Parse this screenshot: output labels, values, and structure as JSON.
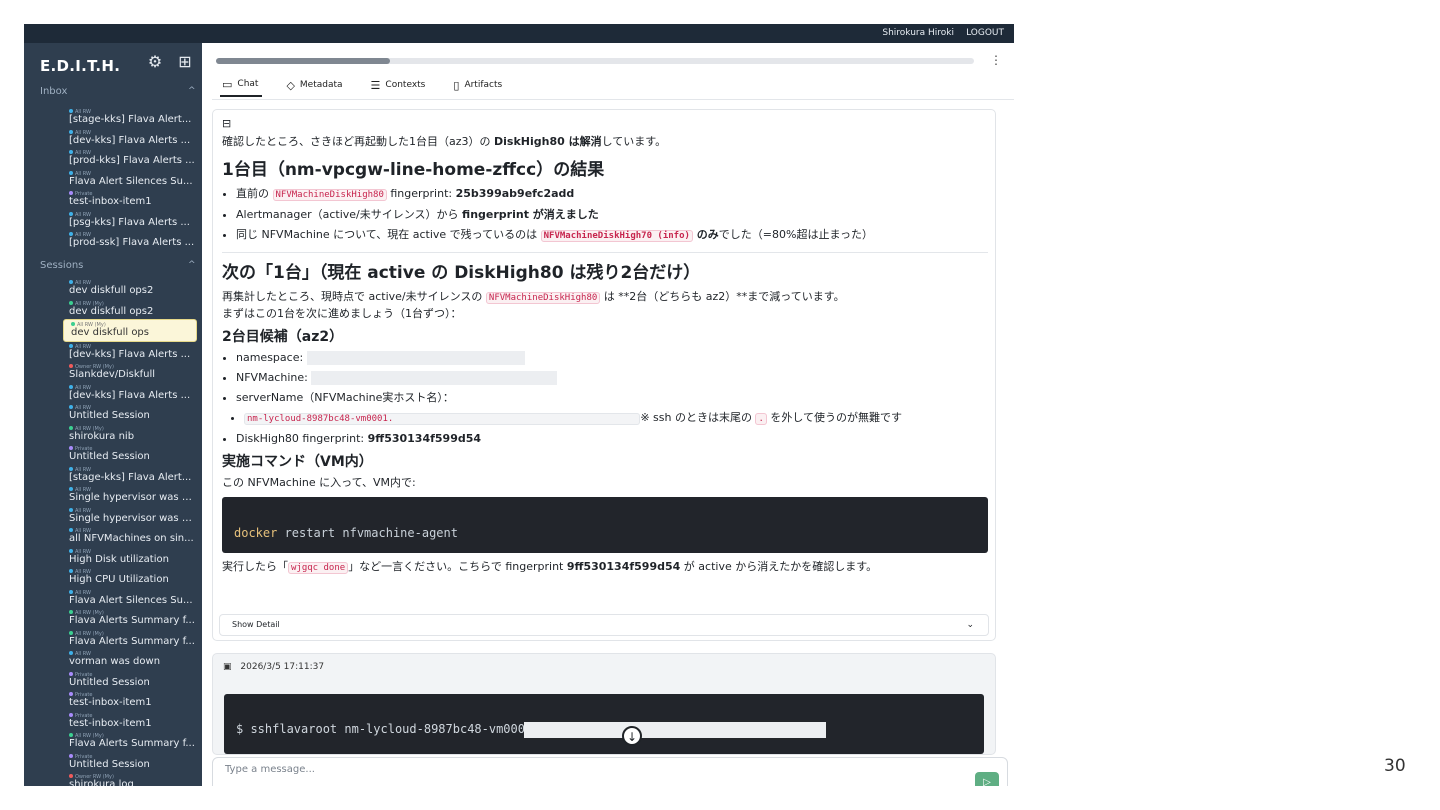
{
  "topbar": {
    "user": "Shirokura Hiroki",
    "logout": "LOGOUT"
  },
  "sidebar": {
    "brand": "E.D.I.T.H.",
    "inbox_label": "Inbox",
    "sessions_label": "Sessions",
    "inbox": [
      {
        "meta": "All RW",
        "label": "[stage-kks] Flava Alert...",
        "dot": "#3fb0e8"
      },
      {
        "meta": "All RW",
        "label": "[dev-kks] Flava Alerts ...",
        "dot": "#3fb0e8"
      },
      {
        "meta": "All RW",
        "label": "[prod-kks] Flava Alerts ...",
        "dot": "#3fb0e8"
      },
      {
        "meta": "All RW",
        "label": "Flava Alert Silences Su...",
        "dot": "#3fb0e8"
      },
      {
        "meta": "Private",
        "label": "test-inbox-item1",
        "dot": "#a78bfa"
      },
      {
        "meta": "All RW",
        "label": "[psg-kks] Flava Alerts ...",
        "dot": "#3fb0e8"
      },
      {
        "meta": "All RW",
        "label": "[prod-ssk] Flava Alerts ...",
        "dot": "#3fb0e8"
      }
    ],
    "sessions": [
      {
        "meta": "All RW",
        "label": "dev diskfull ops2",
        "dot": "#3fb0e8"
      },
      {
        "meta": "All RW (My)",
        "label": "dev diskfull ops2",
        "dot": "#3ccf91"
      },
      {
        "meta": "All RW (My)",
        "label": "dev diskfull ops",
        "dot": "#3ccf91",
        "active": true
      },
      {
        "meta": "All RW",
        "label": "[dev-kks] Flava Alerts ...",
        "dot": "#3fb0e8"
      },
      {
        "meta": "Owner RW (My)",
        "label": "Slankdev/Diskfull",
        "dot": "#ef5b5b"
      },
      {
        "meta": "All RW",
        "label": "[dev-kks] Flava Alerts ...",
        "dot": "#3fb0e8"
      },
      {
        "meta": "All RW",
        "label": "Untitled Session",
        "dot": "#3fb0e8"
      },
      {
        "meta": "All RW (My)",
        "label": "shirokura nib",
        "dot": "#3ccf91"
      },
      {
        "meta": "Private",
        "label": "Untitled Session",
        "dot": "#a78bfa"
      },
      {
        "meta": "All RW",
        "label": "[stage-kks] Flava Alert...",
        "dot": "#3fb0e8"
      },
      {
        "meta": "All RW",
        "label": "Single hypervisor was d...",
        "dot": "#3fb0e8"
      },
      {
        "meta": "All RW",
        "label": "Single hypervisor was d...",
        "dot": "#3fb0e8"
      },
      {
        "meta": "All RW",
        "label": "all NFVMachines on sin...",
        "dot": "#3fb0e8"
      },
      {
        "meta": "All RW",
        "label": "High Disk utilization",
        "dot": "#3fb0e8"
      },
      {
        "meta": "All RW",
        "label": "High CPU Utilization",
        "dot": "#3fb0e8"
      },
      {
        "meta": "All RW",
        "label": "Flava Alert Silences Su...",
        "dot": "#3fb0e8"
      },
      {
        "meta": "All RW (My)",
        "label": "Flava Alerts Summary f...",
        "dot": "#3ccf91"
      },
      {
        "meta": "All RW (My)",
        "label": "Flava Alerts Summary f...",
        "dot": "#3ccf91"
      },
      {
        "meta": "All RW",
        "label": "vorman was down",
        "dot": "#3fb0e8"
      },
      {
        "meta": "Private",
        "label": "Untitled Session",
        "dot": "#a78bfa"
      },
      {
        "meta": "Private",
        "label": "test-inbox-item1",
        "dot": "#a78bfa"
      },
      {
        "meta": "Private",
        "label": "test-inbox-item1",
        "dot": "#a78bfa"
      },
      {
        "meta": "All RW (My)",
        "label": "Flava Alerts Summary f...",
        "dot": "#3ccf91"
      },
      {
        "meta": "Private",
        "label": "Untitled Session",
        "dot": "#a78bfa"
      },
      {
        "meta": "Owner RW (My)",
        "label": "shirokura log",
        "dot": "#ef5b5b"
      }
    ]
  },
  "main": {
    "progress": 0.23,
    "tabs": [
      {
        "icon": "chat-icon",
        "label": "Chat"
      },
      {
        "icon": "tag-icon",
        "label": "Metadata"
      },
      {
        "icon": "database-icon",
        "label": "Contexts"
      },
      {
        "icon": "file-icon",
        "label": "Artifacts"
      }
    ],
    "message": {
      "intro_a": "確認したところ、さきほど再起動した1台目（az3）の ",
      "intro_b": "DiskHigh80 は解消",
      "intro_c": "しています。",
      "h1": "1台目（nm-vpcgw-line-home-zffcc）の結果",
      "b1_a": "直前の ",
      "b1_code": "NFVMachineDiskHigh80",
      "b1_b": " fingerprint: ",
      "b1_c": "25b399ab9efc2add",
      "b2_a": "Alertmanager（active/未サイレンス）から ",
      "b2_b": "fingerprint が消えました",
      "b3_a": "同じ NFVMachine について、現在 active で残っているのは ",
      "b3_code": "NFVMachineDiskHigh70 (info)",
      "b3_b": " のみ",
      "b3_c": "でした（=80%超は止まった）",
      "h2": "次の「1台」（現在 active の DiskHigh80 は残り2台だけ）",
      "p2_a": "再集計したところ、現時点で active/未サイレンスの ",
      "p2_code": "NFVMachineDiskHigh80",
      "p2_b": " は **2台（どちらも az2）**まで減っています。",
      "p2_c": "まずはこの1台を次に進めましょう（1台ずつ）：",
      "h3": "2台目候補（az2）",
      "c1": "namespace:",
      "c2": "NFVMachine:",
      "c3": "serverName（NFVMachine実ホスト名）：",
      "c4_code": "nm-lycloud-8987bc48-vm0001.",
      "c4_note_a": "※ ssh のときは末尾の ",
      "c4_note_code": ".",
      "c4_note_b": " を外して使うのが無難です",
      "c5_a": "DiskHigh80 fingerprint: ",
      "c5_b": "9ff530134f599d54",
      "h4": "実施コマンド（VM内）",
      "p4": "この NFVMachine に入って、VM内で:",
      "cmd_kw": "docker",
      "cmd_rest": " restart nfvmachine-agent",
      "p5_a": "実行したら「",
      "p5_code": "wjgqc done",
      "p5_b": "」など一言ください。こちらで fingerprint ",
      "p5_c": "9ff530134f599d54",
      "p5_d": " が active から消えたかを確認します。",
      "detail": "Show Detail"
    },
    "message2": {
      "timestamp": "2026/3/5 17:11:37",
      "cmd": "$ sshflavaroot nm-lycloud-8987bc48-vm0001"
    },
    "composer_placeholder": "Type a message..."
  },
  "page_number": "30"
}
